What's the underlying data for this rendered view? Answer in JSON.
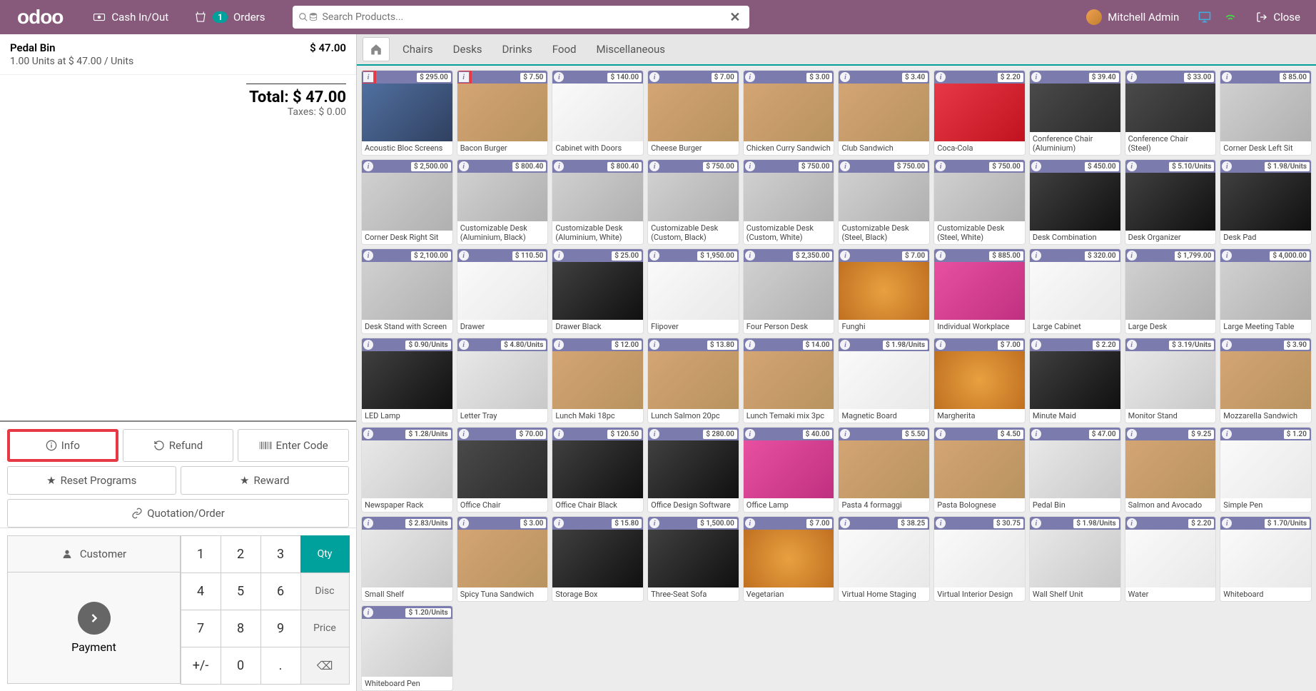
{
  "topbar": {
    "logo": "odoo",
    "cashInOut": "Cash In/Out",
    "ordersLabel": "Orders",
    "ordersBadge": "1",
    "searchPlaceholder": "Search Products...",
    "userName": "Mitchell Admin",
    "closeLabel": "Close"
  },
  "order": {
    "lineName": "Pedal Bin",
    "lineTotal": "$ 47.00",
    "lineDetail": "1.00 Units at $ 47.00 / Units",
    "totalLabel": "Total: $ 47.00",
    "taxesLabel": "Taxes: $ 0.00"
  },
  "actions": {
    "info": "Info",
    "refund": "Refund",
    "enterCode": "Enter Code",
    "resetPrograms": "Reset Programs",
    "reward": "Reward",
    "quotationOrder": "Quotation/Order"
  },
  "numpad": {
    "customer": "Customer",
    "payment": "Payment",
    "qty": "Qty",
    "disc": "Disc",
    "price": "Price",
    "k1": "1",
    "k2": "2",
    "k3": "3",
    "k4": "4",
    "k5": "5",
    "k6": "6",
    "k7": "7",
    "k8": "8",
    "k9": "9",
    "k0": "0",
    "kdot": ".",
    "kpm": "+/-"
  },
  "categories": [
    "Chairs",
    "Desks",
    "Drinks",
    "Food",
    "Miscellaneous"
  ],
  "products": [
    {
      "name": "Acoustic Bloc Screens",
      "price": "$ 295.00",
      "img": "pi-blue",
      "hi": true
    },
    {
      "name": "Bacon Burger",
      "price": "$ 7.50",
      "img": "pi-food",
      "hi": true
    },
    {
      "name": "Cabinet with Doors",
      "price": "$ 140.00",
      "img": "pi-white"
    },
    {
      "name": "Cheese Burger",
      "price": "$ 7.00",
      "img": "pi-food"
    },
    {
      "name": "Chicken Curry Sandwich",
      "price": "$ 3.00",
      "img": "pi-food"
    },
    {
      "name": "Club Sandwich",
      "price": "$ 3.40",
      "img": "pi-food"
    },
    {
      "name": "Coca-Cola",
      "price": "$ 2.20",
      "img": "pi-drink"
    },
    {
      "name": "Conference Chair (Aluminium)",
      "price": "$ 39.40",
      "img": "pi-chair"
    },
    {
      "name": "Conference Chair (Steel)",
      "price": "$ 33.00",
      "img": "pi-chair"
    },
    {
      "name": "Corner Desk Left Sit",
      "price": "$ 85.00",
      "img": "pi-desk"
    },
    {
      "name": "Corner Desk Right Sit",
      "price": "$ 2,500.00",
      "img": "pi-desk"
    },
    {
      "name": "Customizable Desk (Aluminium, Black)",
      "price": "$ 800.40",
      "img": "pi-desk"
    },
    {
      "name": "Customizable Desk (Aluminium, White)",
      "price": "$ 800.40",
      "img": "pi-desk"
    },
    {
      "name": "Customizable Desk (Custom, Black)",
      "price": "$ 750.00",
      "img": "pi-desk"
    },
    {
      "name": "Customizable Desk (Custom, White)",
      "price": "$ 750.00",
      "img": "pi-desk"
    },
    {
      "name": "Customizable Desk (Steel, Black)",
      "price": "$ 750.00",
      "img": "pi-desk"
    },
    {
      "name": "Customizable Desk (Steel, White)",
      "price": "$ 750.00",
      "img": "pi-desk"
    },
    {
      "name": "Desk Combination",
      "price": "$ 450.00",
      "img": "pi-black"
    },
    {
      "name": "Desk Organizer",
      "price": "$ 5.10/Units",
      "img": "pi-black"
    },
    {
      "name": "Desk Pad",
      "price": "$ 1.98/Units",
      "img": "pi-black"
    },
    {
      "name": "Desk Stand with Screen",
      "price": "$ 2,100.00",
      "img": "pi-desk"
    },
    {
      "name": "Drawer",
      "price": "$ 110.50",
      "img": "pi-white"
    },
    {
      "name": "Drawer Black",
      "price": "$ 25.00",
      "img": "pi-black"
    },
    {
      "name": "Flipover",
      "price": "$ 1,950.00",
      "img": "pi-white"
    },
    {
      "name": "Four Person Desk",
      "price": "$ 2,350.00",
      "img": "pi-desk"
    },
    {
      "name": "Funghi",
      "price": "$ 7.00",
      "img": "pi-pizza"
    },
    {
      "name": "Individual Workplace",
      "price": "$ 885.00",
      "img": "pi-pink"
    },
    {
      "name": "Large Cabinet",
      "price": "$ 320.00",
      "img": "pi-white"
    },
    {
      "name": "Large Desk",
      "price": "$ 1,799.00",
      "img": "pi-desk"
    },
    {
      "name": "Large Meeting Table",
      "price": "$ 4,000.00",
      "img": "pi-desk"
    },
    {
      "name": "LED Lamp",
      "price": "$ 0.90/Units",
      "img": "pi-black"
    },
    {
      "name": "Letter Tray",
      "price": "$ 4.80/Units",
      "img": "pi-misc"
    },
    {
      "name": "Lunch Maki 18pc",
      "price": "$ 12.00",
      "img": "pi-food"
    },
    {
      "name": "Lunch Salmon 20pc",
      "price": "$ 13.80",
      "img": "pi-food"
    },
    {
      "name": "Lunch Temaki mix 3pc",
      "price": "$ 14.00",
      "img": "pi-food"
    },
    {
      "name": "Magnetic Board",
      "price": "$ 1.98/Units",
      "img": "pi-white"
    },
    {
      "name": "Margherita",
      "price": "$ 7.00",
      "img": "pi-pizza"
    },
    {
      "name": "Minute Maid",
      "price": "$ 2.20",
      "img": "pi-black"
    },
    {
      "name": "Monitor Stand",
      "price": "$ 3.19/Units",
      "img": "pi-misc"
    },
    {
      "name": "Mozzarella Sandwich",
      "price": "$ 3.90",
      "img": "pi-food"
    },
    {
      "name": "Newspaper Rack",
      "price": "$ 1.28/Units",
      "img": "pi-misc"
    },
    {
      "name": "Office Chair",
      "price": "$ 70.00",
      "img": "pi-chair"
    },
    {
      "name": "Office Chair Black",
      "price": "$ 120.50",
      "img": "pi-black"
    },
    {
      "name": "Office Design Software",
      "price": "$ 280.00",
      "img": "pi-black"
    },
    {
      "name": "Office Lamp",
      "price": "$ 40.00",
      "img": "pi-pink"
    },
    {
      "name": "Pasta 4 formaggi",
      "price": "$ 5.50",
      "img": "pi-food"
    },
    {
      "name": "Pasta Bolognese",
      "price": "$ 4.50",
      "img": "pi-food"
    },
    {
      "name": "Pedal Bin",
      "price": "$ 47.00",
      "img": "pi-misc"
    },
    {
      "name": "Salmon and Avocado",
      "price": "$ 9.25",
      "img": "pi-food"
    },
    {
      "name": "Simple Pen",
      "price": "$ 1.20",
      "img": "pi-white"
    },
    {
      "name": "Small Shelf",
      "price": "$ 2.83/Units",
      "img": "pi-misc"
    },
    {
      "name": "Spicy Tuna Sandwich",
      "price": "$ 3.00",
      "img": "pi-food"
    },
    {
      "name": "Storage Box",
      "price": "$ 15.80",
      "img": "pi-black"
    },
    {
      "name": "Three-Seat Sofa",
      "price": "$ 1,500.00",
      "img": "pi-black"
    },
    {
      "name": "Vegetarian",
      "price": "$ 7.00",
      "img": "pi-pizza"
    },
    {
      "name": "Virtual Home Staging",
      "price": "$ 38.25",
      "img": "pi-white"
    },
    {
      "name": "Virtual Interior Design",
      "price": "$ 30.75",
      "img": "pi-white"
    },
    {
      "name": "Wall Shelf Unit",
      "price": "$ 1.98/Units",
      "img": "pi-misc"
    },
    {
      "name": "Water",
      "price": "$ 2.20",
      "img": "pi-white"
    },
    {
      "name": "Whiteboard",
      "price": "$ 1.70/Units",
      "img": "pi-white"
    },
    {
      "name": "Whiteboard Pen",
      "price": "$ 1.20/Units",
      "img": "pi-misc"
    }
  ]
}
